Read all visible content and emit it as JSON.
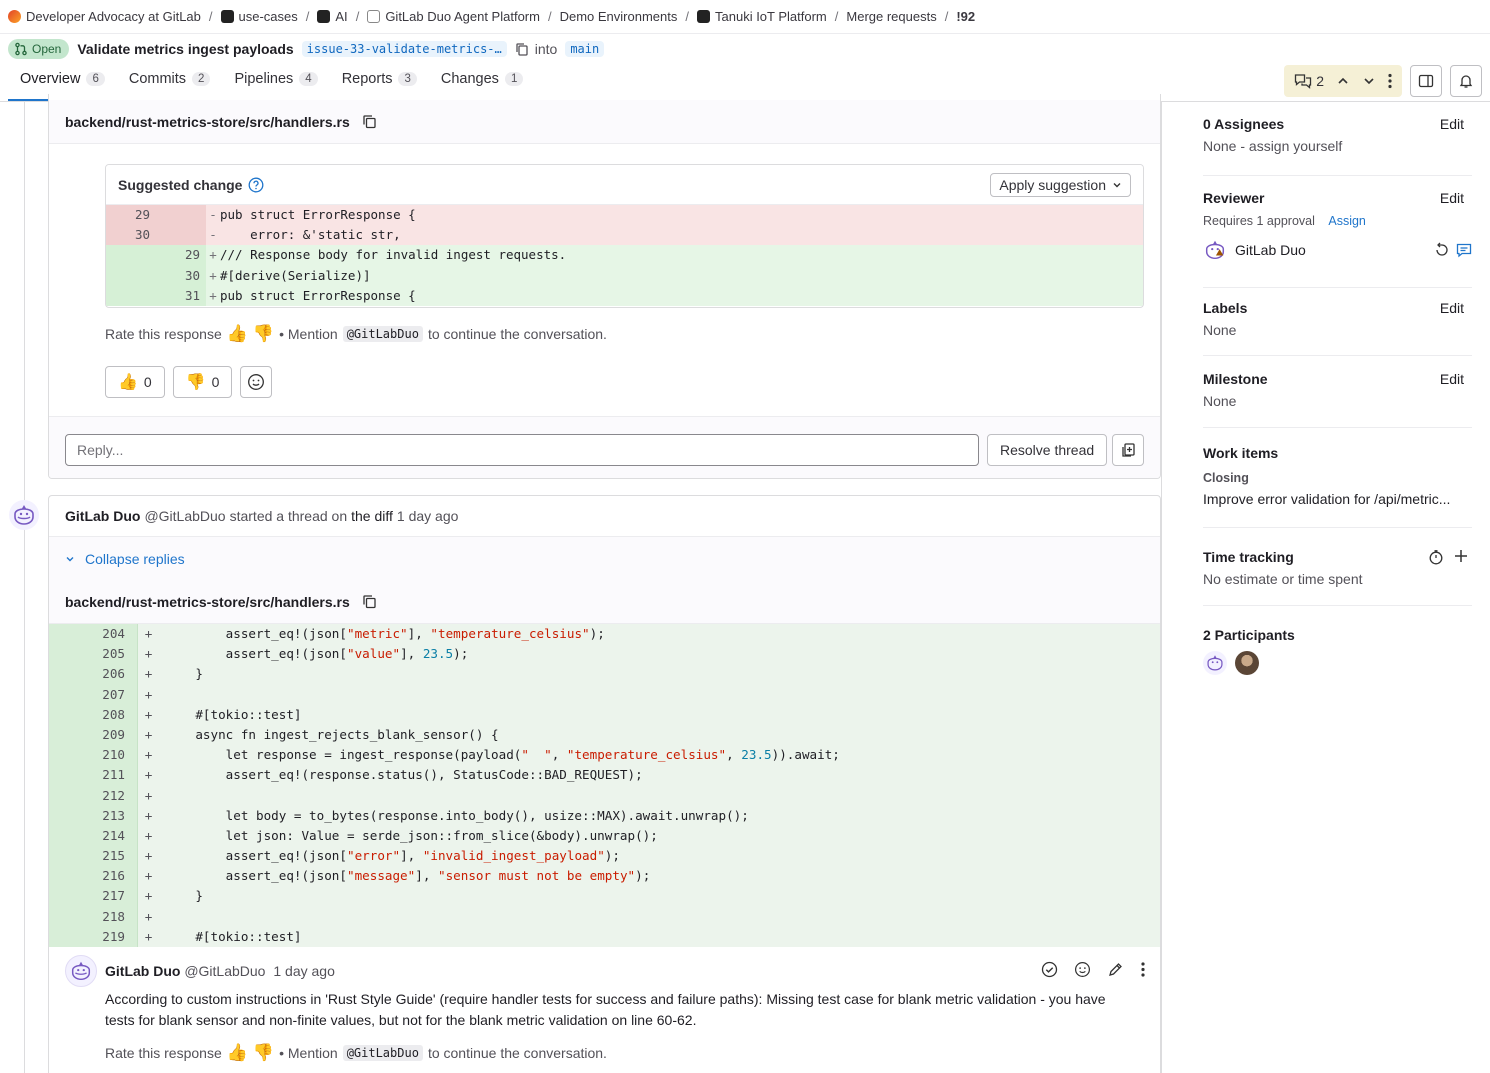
{
  "breadcrumb": [
    {
      "label": "Developer Advocacy at GitLab",
      "icon": "gitlab-heart-icon",
      "color": "#e24329"
    },
    {
      "label": "use-cases",
      "icon": "project-icon",
      "color": "#222"
    },
    {
      "label": "AI",
      "icon": "ai-icon",
      "color": "#222"
    },
    {
      "label": "GitLab Duo Agent Platform",
      "icon": "duo-platform-icon",
      "color": "#fff"
    },
    {
      "label": "Demo Environments",
      "icon": "",
      "color": ""
    },
    {
      "label": "Tanuki IoT Platform",
      "icon": "tanuki-icon",
      "color": "#222"
    },
    {
      "label": "Merge requests",
      "icon": "",
      "color": ""
    },
    {
      "label": "!92",
      "icon": "",
      "color": ""
    }
  ],
  "mr": {
    "status": "Open",
    "title": "Validate metrics ingest payloads",
    "source_branch": "issue-33-validate-metrics-…",
    "into_label": "into",
    "target_branch": "main"
  },
  "tabs": [
    {
      "label": "Overview",
      "count": "6"
    },
    {
      "label": "Commits",
      "count": "2"
    },
    {
      "label": "Pipelines",
      "count": "4"
    },
    {
      "label": "Reports",
      "count": "3"
    },
    {
      "label": "Changes",
      "count": "1"
    }
  ],
  "discussion_count": "2",
  "thread1": {
    "file": "backend/rust-metrics-store/src/handlers.rs",
    "suggested_label": "Suggested change",
    "apply_label": "Apply suggestion",
    "diff": [
      {
        "type": "del",
        "old": "29",
        "new": "",
        "sign": "-",
        "code": "pub struct ErrorResponse {"
      },
      {
        "type": "del",
        "old": "30",
        "new": "",
        "sign": "-",
        "code": "    error: &'static str,"
      },
      {
        "type": "add",
        "old": "",
        "new": "29",
        "sign": "+",
        "code": "/// Response body for invalid ingest requests."
      },
      {
        "type": "add",
        "old": "",
        "new": "30",
        "sign": "+",
        "code": "#[derive(Serialize)]"
      },
      {
        "type": "add",
        "old": "",
        "new": "31",
        "sign": "+",
        "code": "pub struct ErrorResponse {"
      }
    ],
    "rate_label": "Rate this response",
    "mention_pre": "• Mention",
    "mention_handle": "@GitLabDuo",
    "mention_post": "to continue the conversation.",
    "thumbs_up": "0",
    "thumbs_down": "0",
    "reply_placeholder": "Reply...",
    "resolve_label": "Resolve thread"
  },
  "thread2": {
    "author": "GitLab Duo",
    "handle": "@GitLabDuo",
    "action": "started a thread on",
    "diff_link": "the diff",
    "time": "1 day ago",
    "collapse_label": "Collapse replies",
    "file": "backend/rust-metrics-store/src/handlers.rs",
    "code": [
      {
        "ln": "204",
        "text": "        assert_eq!(json[\"metric\"], \"temperature_celsius\");"
      },
      {
        "ln": "205",
        "text": "        assert_eq!(json[\"value\"], 23.5);"
      },
      {
        "ln": "206",
        "text": "    }"
      },
      {
        "ln": "207",
        "text": ""
      },
      {
        "ln": "208",
        "text": "    #[tokio::test]"
      },
      {
        "ln": "209",
        "text": "    async fn ingest_rejects_blank_sensor() {"
      },
      {
        "ln": "210",
        "text": "        let response = ingest_response(payload(\"  \", \"temperature_celsius\", 23.5)).await;"
      },
      {
        "ln": "211",
        "text": "        assert_eq!(response.status(), StatusCode::BAD_REQUEST);"
      },
      {
        "ln": "212",
        "text": ""
      },
      {
        "ln": "213",
        "text": "        let body = to_bytes(response.into_body(), usize::MAX).await.unwrap();"
      },
      {
        "ln": "214",
        "text": "        let json: Value = serde_json::from_slice(&body).unwrap();"
      },
      {
        "ln": "215",
        "text": "        assert_eq!(json[\"error\"], \"invalid_ingest_payload\");"
      },
      {
        "ln": "216",
        "text": "        assert_eq!(json[\"message\"], \"sensor must not be empty\");"
      },
      {
        "ln": "217",
        "text": "    }"
      },
      {
        "ln": "218",
        "text": ""
      },
      {
        "ln": "219",
        "text": "    #[tokio::test]"
      }
    ],
    "comment": {
      "author": "GitLab Duo",
      "handle": "@GitLabDuo",
      "time": "1 day ago",
      "body": "According to custom instructions in 'Rust Style Guide' (require handler tests for success and failure paths): Missing test case for blank metric validation - you have tests for blank sensor and non-finite values, but not for the blank metric validation on line 60-62.",
      "rate_label": "Rate this response",
      "mention_pre": "• Mention",
      "mention_handle": "@GitLabDuo",
      "mention_post": "to continue the conversation."
    }
  },
  "sidebar": {
    "assignees_title": "0 Assignees",
    "assignees_value": "None - assign yourself",
    "edit_label": "Edit",
    "reviewer_title": "Reviewer",
    "reviewer_requires": "Requires 1 approval",
    "reviewer_assign": "Assign",
    "reviewer_name": "GitLab Duo",
    "labels_title": "Labels",
    "labels_value": "None",
    "milestone_title": "Milestone",
    "milestone_value": "None",
    "workitems_title": "Work items",
    "workitems_closing": "Closing",
    "workitems_value": "Improve error validation for /api/metric...",
    "time_title": "Time tracking",
    "time_value": "No estimate or time spent",
    "participants_title": "2 Participants"
  }
}
